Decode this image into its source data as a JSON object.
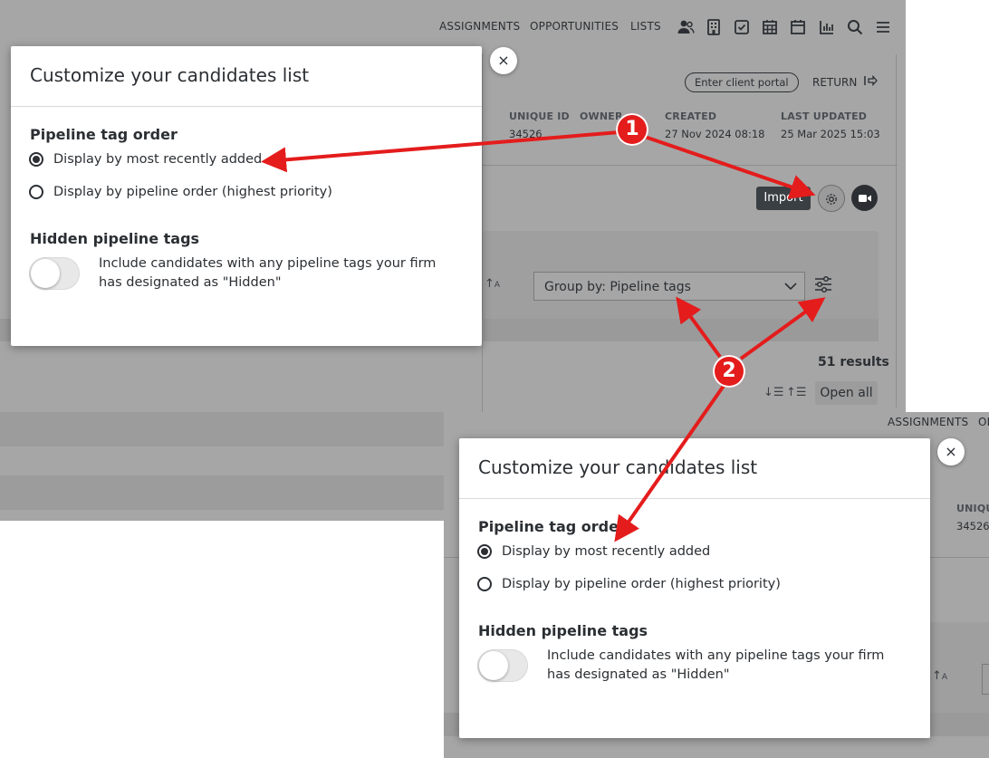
{
  "top_nav": {
    "assignments": "ASSIGNMENTS",
    "opportunities": "OPPORTUNITIES",
    "lists": "LISTS",
    "icons": [
      "people-icon",
      "building-icon",
      "checkbox-icon",
      "calendar-grid-icon",
      "calendar-icon",
      "chart-icon",
      "search-icon",
      "menu-icon"
    ]
  },
  "record_header": {
    "client_portal_button": "Enter client portal",
    "return_label": "RETURN",
    "columns": [
      {
        "label": "UNIQUE ID",
        "value": "34526"
      },
      {
        "label": "OWNER",
        "value": ""
      },
      {
        "label": "CREATED",
        "value": "27 Nov 2024 08:18"
      },
      {
        "label": "LAST UPDATED",
        "value": "25 Mar 2025 15:03"
      }
    ]
  },
  "candidates_toolbar": {
    "import_button": "Import",
    "group_by_value": "Group by: Pipeline tags",
    "results_count": "51 results",
    "open_all_button": "Open all"
  },
  "modal": {
    "title": "Customize your candidates list",
    "pipeline_order_heading": "Pipeline tag order",
    "options": [
      {
        "label": "Display by most recently added",
        "checked": true
      },
      {
        "label": "Display by pipeline order (highest priority)",
        "checked": false
      }
    ],
    "hidden_heading": "Hidden pipeline tags",
    "hidden_description": "Include candidates with any pipeline tags your firm has designated as \"Hidden\"",
    "hidden_toggle_on": false,
    "close_glyph": "×"
  },
  "second_window": {
    "nav_assignments": "ASSIGNMENTS",
    "nav_opportunities_partial": "OI",
    "unique_label_partial": "UNIQU",
    "unique_value_partial": "34526"
  },
  "annotations": {
    "badge_1": "1",
    "badge_2": "2",
    "color": "#e41c1c"
  }
}
